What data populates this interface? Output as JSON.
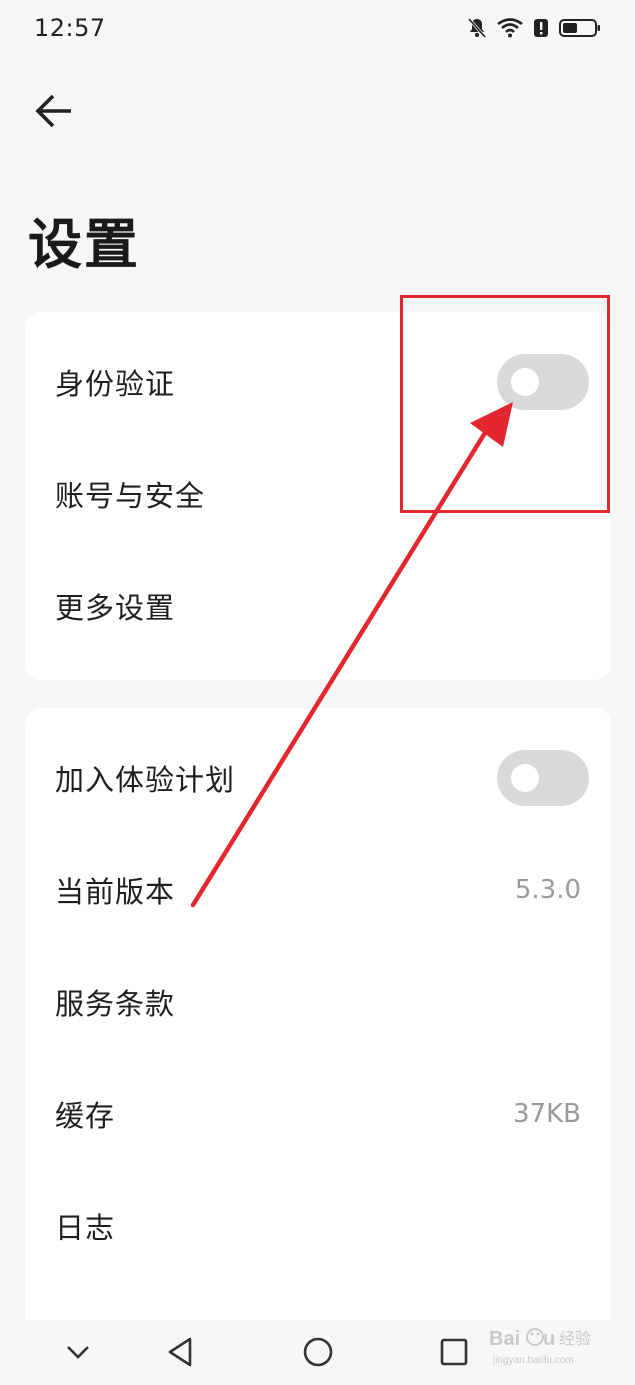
{
  "status_bar": {
    "time": "12:57",
    "icons": [
      "mute-bell-icon",
      "wifi-icon",
      "alert-icon",
      "battery-icon"
    ]
  },
  "header": {
    "back_icon": "arrow-left-icon",
    "title": "设置"
  },
  "card1": {
    "items": [
      {
        "label": "身份验证",
        "control": "toggle",
        "state": "off"
      },
      {
        "label": "账号与安全"
      },
      {
        "label": "更多设置"
      }
    ]
  },
  "card2": {
    "items": [
      {
        "label": "加入体验计划",
        "control": "toggle",
        "state": "off"
      },
      {
        "label": "当前版本",
        "value": "5.3.0"
      },
      {
        "label": "服务条款"
      },
      {
        "label": "缓存",
        "value": "37KB"
      },
      {
        "label": "日志"
      }
    ]
  },
  "nav_bar": {
    "icons": [
      "chevron-down-icon",
      "back-triangle-icon",
      "home-circle-icon",
      "recents-square-icon"
    ]
  },
  "annotation": {
    "color": "#e4262f",
    "target": "身份验证 toggle"
  },
  "watermark": {
    "brand": "Baidu 经验",
    "url": "jingyan.baidu.com"
  },
  "colors": {
    "background": "#f7f7f7",
    "card": "#ffffff",
    "toggle_off": "#d9d9d9",
    "value_text": "#9a9a9a"
  }
}
